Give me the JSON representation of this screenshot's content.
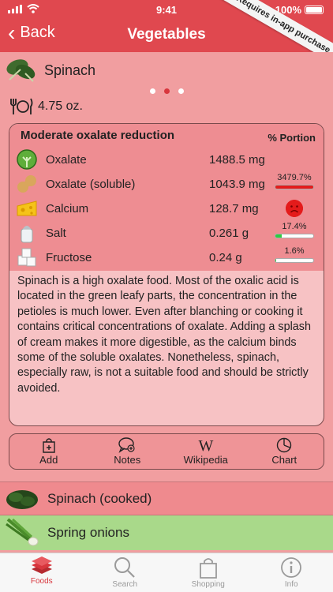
{
  "status_bar": {
    "time": "9:41",
    "battery": "100%"
  },
  "nav": {
    "back_label": "Back",
    "title": "Vegetables",
    "ribbon": "Requires in-app purchase"
  },
  "current_item": {
    "name": "Spinach",
    "portion": "4.75 oz."
  },
  "pager": {
    "pages": 3,
    "active_index": 1
  },
  "card": {
    "title": "Moderate oxalate reduction",
    "portion_header": "% Portion",
    "rows": [
      {
        "label": "Oxalate",
        "value": "1488.5 mg",
        "percent": "",
        "icon": "broccoli-icon"
      },
      {
        "label": "Oxalate (soluble)",
        "value": "1043.9 mg",
        "percent": "3479.7%",
        "bar_fraction": 1.0,
        "bar_color": "#e41b1b",
        "icon": "peanut-icon"
      },
      {
        "label": "Calcium",
        "value": "128.7 mg",
        "percent": "",
        "status": "frown-icon",
        "icon": "cheese-icon"
      },
      {
        "label": "Salt",
        "value": "0.261 g",
        "percent": "17.4%",
        "bar_fraction": 0.174,
        "bar_color": "#2ecc40",
        "icon": "salt-shaker-icon"
      },
      {
        "label": "Fructose",
        "value": "0.24 g",
        "percent": "1.6%",
        "bar_fraction": 0.016,
        "bar_color": "#2ecc40",
        "icon": "sugar-cubes-icon"
      }
    ],
    "description": "Spinach is a high oxalate food. Most of the oxalic acid is located in the green leafy parts, the concentration in the petioles is much lower. Even after blanching or cooking it contains critical concentrations of oxalate. Adding a splash of cream makes it more digestible, as the calcium binds some of the soluble oxalates. Nonetheless, spinach, especially raw, is not a suitable food and should be strictly avoided."
  },
  "toolbar": [
    {
      "label": "Add",
      "icon": "shopping-bag-add-icon"
    },
    {
      "label": "Notes",
      "icon": "notes-icon"
    },
    {
      "label": "Wikipedia",
      "icon": "wikipedia-icon"
    },
    {
      "label": "Chart",
      "icon": "pie-chart-icon"
    }
  ],
  "list": [
    {
      "name": "Spinach (cooked)",
      "icon": "cooked-spinach-icon",
      "background": "#ef8a8e"
    },
    {
      "name": "Spring onions",
      "icon": "spring-onion-icon",
      "background": "#a9d98a"
    }
  ],
  "tabs": [
    {
      "label": "Foods",
      "icon": "foods-icon",
      "active": true
    },
    {
      "label": "Search",
      "icon": "search-icon",
      "active": false
    },
    {
      "label": "Shopping",
      "icon": "shopping-bag-icon",
      "active": false
    },
    {
      "label": "Info",
      "icon": "info-icon",
      "active": false
    }
  ],
  "colors": {
    "nav": "#e0484f",
    "accent": "#d8363d",
    "background": "#f19ea0",
    "card_header": "#ee8d92",
    "card_body": "#f7c2c4"
  }
}
